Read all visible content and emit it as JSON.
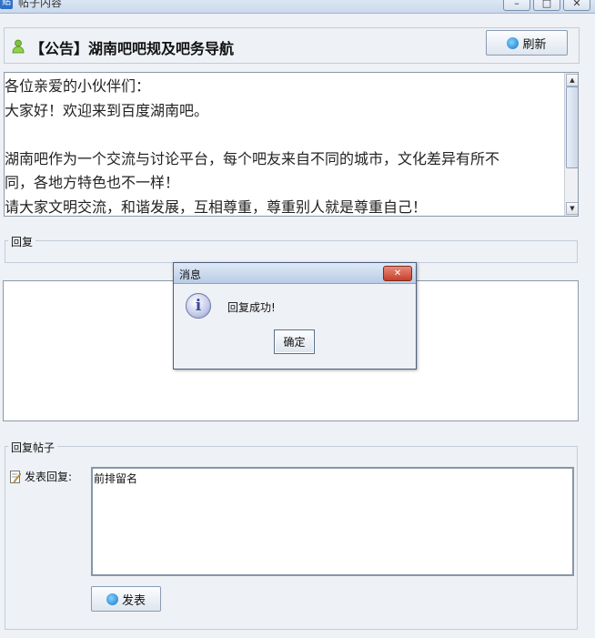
{
  "window": {
    "title": "帖子内容",
    "app_icon": "贴"
  },
  "header": {
    "post_title": "【公告】湖南吧吧规及吧务导航",
    "refresh_label": "刷新"
  },
  "content": {
    "lines": [
      "各位亲爱的小伙伴们：",
      "大家好！欢迎来到百度湖南吧。",
      "",
      "湖南吧作为一个交流与讨论平台，每个吧友来自不同的城市，文化差异有所不",
      "同，各地方特色也不一样！",
      "请大家文明交流，和谐发展，互相尊重，尊重别人就是尊重自己！"
    ]
  },
  "reply_section": {
    "label": "回复"
  },
  "post_reply": {
    "group_label": "回复帖子",
    "field_label": "发表回复:",
    "input_value": "前排留名",
    "submit_label": "发表"
  },
  "dialog": {
    "title": "消息",
    "message": "回复成功!",
    "ok_label": "确定",
    "close_symbol": "✕",
    "info_symbol": "i"
  }
}
